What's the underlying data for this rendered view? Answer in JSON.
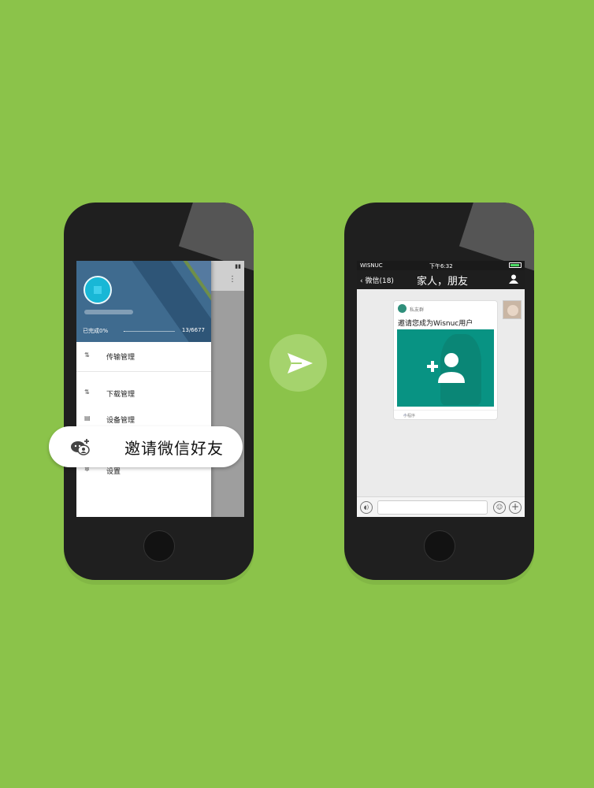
{
  "drawer": {
    "progress_label": "已完成0%",
    "progress_value": "13/6677",
    "progress_fraction": 0.002,
    "items": [
      {
        "label": "传输管理",
        "icon": "transfer-icon"
      },
      {
        "label": "下载管理",
        "icon": "download-icon"
      },
      {
        "label": "设备管理",
        "icon": "device-icon"
      },
      {
        "label": "设置",
        "icon": "gear-icon"
      }
    ]
  },
  "invite": {
    "label": "邀请微信好友",
    "icon": "wechat-add-friend-icon"
  },
  "arrow": {
    "icon": "send-arrow-icon"
  },
  "chat": {
    "status": {
      "carrier": "WISNUC",
      "time": "下午6:32"
    },
    "back_label": "微信(18)",
    "title": "家人，朋友",
    "card": {
      "source": "私友群",
      "title": "邀请您成为Wisnuc用户",
      "footer": "小程序"
    }
  },
  "colors": {
    "background": "#8bc34a",
    "accent_teal": "#089383",
    "avatar_cyan": "#18b7d6"
  }
}
